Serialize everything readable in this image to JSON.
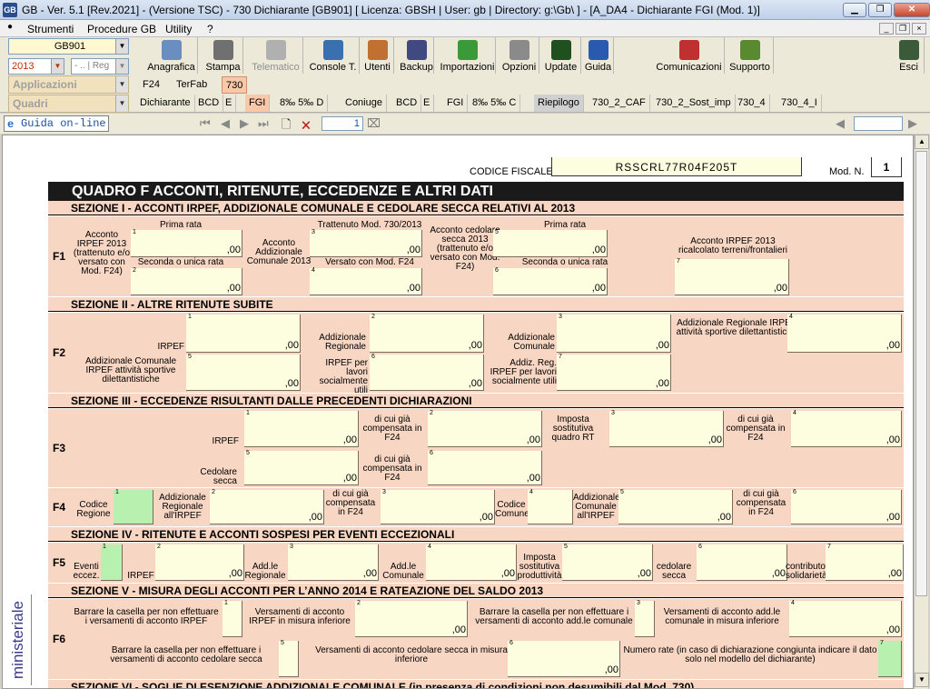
{
  "window": {
    "title": "GB - Ver. 5.1 [Rev.2021] - (Versione TSC) - 730 Dichiarante [GB901]     [ Licenza: GBSH | User: gb | Directory: g:\\Gb\\ ] - [A_DA4 - Dichiarante FGI (Mod. 1)]",
    "icon": "GB",
    "min": "▁",
    "max": "❐",
    "close": "✕"
  },
  "menu": {
    "items": [
      "Strumenti",
      "Procedure GB",
      "Utility",
      "?"
    ],
    "mdi": [
      "_",
      "❐",
      "×"
    ]
  },
  "toolbar": {
    "combo_code": "GB901",
    "combo_year": "2013",
    "combo_reg": "- .. | Reg",
    "buttons": [
      {
        "label": "Anagrafica",
        "icon": "id-card-icon",
        "color": "#6a8ec0"
      },
      {
        "label": "Stampa",
        "icon": "printer-icon",
        "color": "#707070"
      },
      {
        "label": "Telematico",
        "icon": "telematic-icon",
        "color": "#b0b0b0",
        "disabled": true
      },
      {
        "label": "Console T.",
        "icon": "console-icon",
        "color": "#3a70b0"
      },
      {
        "label": "Utenti",
        "icon": "users-icon",
        "color": "#c07030"
      },
      {
        "label": "Backup",
        "icon": "backup-icon",
        "color": "#404a80"
      },
      {
        "label": "Importazioni",
        "icon": "import-icon",
        "color": "#3a9a3a"
      },
      {
        "label": "Opzioni",
        "icon": "wrench-icon",
        "color": "#8a8a8a"
      },
      {
        "label": "Update",
        "icon": "update-icon",
        "color": "#205020"
      },
      {
        "label": "Guida",
        "icon": "help-icon",
        "color": "#2a5ab0"
      },
      {
        "label": "Comunicazioni",
        "icon": "notice-icon",
        "color": "#c03030"
      },
      {
        "label": "Supporto",
        "icon": "support-icon",
        "color": "#5a8a30"
      },
      {
        "label": "Esci",
        "icon": "exit-icon",
        "color": "#3a5a3a"
      }
    ]
  },
  "combos": {
    "applicazioni": "Applicazioni",
    "quadri": "Quadri"
  },
  "tabs1": [
    "F24",
    "TerFab",
    "730"
  ],
  "tabs2": [
    "Dichiarante",
    "BCD",
    "E",
    "FGI",
    "8‰  5‰ D",
    "Coniuge",
    "BCD",
    "E",
    "FGI",
    "8‰  5‰ C",
    "Riepilogo",
    "730_2_CAF",
    "730_2_Sost_imp",
    "730_4",
    "730_4_I"
  ],
  "nav": {
    "guida": "Guida on-line",
    "page": "1"
  },
  "form": {
    "codice_fiscale_label": "CODICE FISCALE",
    "codice_fiscale": "RSSCRL77R04F205T",
    "mod_n_label": "Mod. N.",
    "mod_n": "1",
    "title": "QUADRO   F   ACCONTI, RITENUTE, ECCEDENZE E ALTRI DATI",
    "sec1": "SEZIONE I  -  ACCONTI IRPEF, ADDIZIONALE COMUNALE E CEDOLARE SECCA RELATIVI AL 2013",
    "sec2": "SEZIONE II  -  ALTRE RITENUTE SUBITE",
    "sec3": "SEZIONE III  -  ECCEDENZE RISULTANTI DALLE PRECEDENTI DICHIARAZIONI",
    "sec4": "SEZIONE IV  -  RITENUTE E ACCONTI SOSPESI PER EVENTI ECCEZIONALI",
    "sec5": "SEZIONE V  -  MISURA DEGLI ACCONTI PER L’ANNO 2014 E RATEAZIONE DEL SALDO 2013",
    "sec6": "SEZIONE VI  -  SOGLIE DI ESENZIONE ADDIZIONALE COMUNALE (in presenza di condizioni non desumibili dal Mod. 730)",
    "zero": ",00",
    "f1": {
      "code": "F1",
      "l1": "Acconto IRPEF 2013 (trattenuto e/o versato con Mod. F24)",
      "c1": "Prima rata",
      "c2": "Seconda o unica rata",
      "l2": "Acconto Addizionale Comunale 2013",
      "c3": "Trattenuto Mod. 730/2013",
      "c4": "Versato con Mod. F24",
      "l3": "Acconto cedolare secca 2013 (trattenuto e/o versato con Mod. F24)",
      "c5": "Prima rata",
      "c6": "Seconda o unica rata",
      "l4": "Acconto IRPEF 2013 ricalcolato terreni/frontalieri"
    },
    "f2": {
      "code": "F2",
      "a": "IRPEF",
      "b": "Addizionale Regionale",
      "c": "Addizionale Comunale",
      "d": "Addizionale Regionale IRPEF attività sportive dilettantistiche",
      "e": "Addizionale Comunale IRPEF attività sportive dilettantistiche",
      "f": "IRPEF per lavori socialmente utili",
      "g": "Addiz. Reg. IRPEF per lavori socialmente utili"
    },
    "f3": {
      "code": "F3",
      "a": "IRPEF",
      "b": "di cui già compensata in F24",
      "c": "Imposta sostitutiva quadro  RT",
      "d": "di cui già compensata in F24",
      "e": "Cedolare secca",
      "f": "di cui già compensata in F24"
    },
    "f4": {
      "code": "F4",
      "a": "Codice Regione",
      "b": "Addizionale Regionale all'IRPEF",
      "c": "di cui già compensata in F24",
      "d": "Codice Comune",
      "e": "Addizionale Comunale all'IRPEF",
      "f": "di cui già compensata in F24"
    },
    "f5": {
      "code": "F5",
      "a": "Eventi eccez.",
      "b": "IRPEF",
      "c": "Add.le Regionale",
      "d": "Add.le Comunale",
      "e": "Imposta sostitutiva produttività",
      "f": "cedolare secca",
      "g": "contributo solidarietà"
    },
    "f6": {
      "code": "F6",
      "a": "Barrare la casella per non effettuare i versamenti di acconto IRPEF",
      "b": "Versamenti di acconto IRPEF in misura inferiore",
      "c": "Barrare la casella per non effettuare i versamenti di acconto add.le comunale",
      "d": "Versamenti di acconto add.le comunale in misura inferiore",
      "e": "Barrare la casella per non effettuare i versamenti di acconto cedolare secca",
      "f": "Versamenti di acconto cedolare secca in misura inferiore",
      "g": "Numero rate (in caso di dichiarazione congiunta indicare il dato solo nel modello del dichiarante)"
    },
    "side": "ministeriale"
  }
}
